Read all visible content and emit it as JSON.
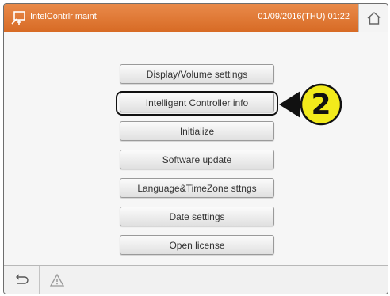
{
  "header": {
    "title": "IntelContrlr maint",
    "datetime": "01/09/2016(THU) 01:22",
    "icons": {
      "app": "tools-icon",
      "home": "home-icon"
    }
  },
  "menu": {
    "items": [
      "Display/Volume settings",
      "Intelligent Controller info",
      "Initialize",
      "Software update",
      "Language&TimeZone sttngs",
      "Date settings",
      "Open license"
    ]
  },
  "callout": {
    "number": "2",
    "fill": "#f2ea1b"
  },
  "footer": {
    "icons": [
      "back-icon",
      "warning-icon"
    ]
  },
  "colors": {
    "header": "#e07a35",
    "background": "#f6f6f6"
  }
}
